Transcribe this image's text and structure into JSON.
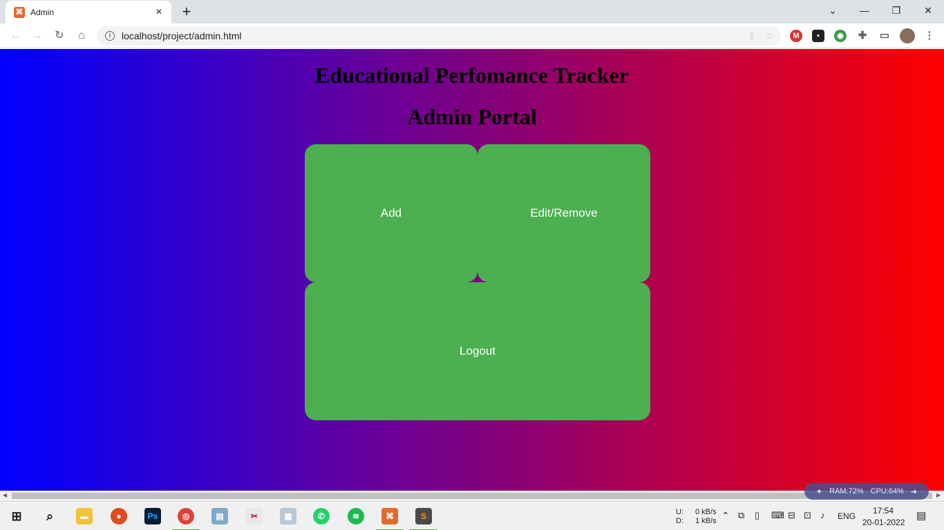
{
  "browser": {
    "tab_title": "Admin",
    "tab_favicon": "xampp-favicon",
    "new_tab": "+",
    "url": "localhost/project/admin.html"
  },
  "page": {
    "title": "Educational Perfomance Tracker",
    "subtitle": "Admin Portal",
    "buttons": {
      "add": "Add",
      "edit_remove": "Edit/Remove",
      "logout": "Logout"
    },
    "colors": {
      "gradient_start": "#0000ff",
      "gradient_mid": "#800080",
      "gradient_end": "#ff0000",
      "button_bg": "#4caf50",
      "button_text": "#ffffff"
    }
  },
  "overlay": {
    "ram": "RAM:72%",
    "cpu": "CPU:64%"
  },
  "taskbar": {
    "net_up_label": "U:",
    "net_down_label": "D:",
    "net_up": "0 kB/s",
    "net_down": "1 kB/s",
    "language": "ENG",
    "time": "17:54",
    "date": "20-01-2022"
  }
}
